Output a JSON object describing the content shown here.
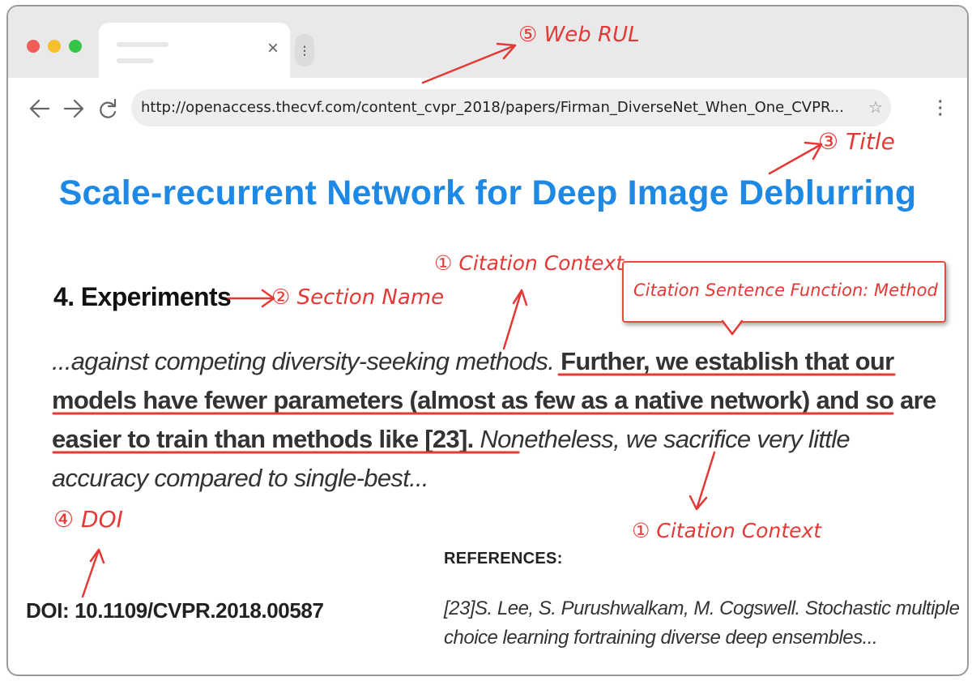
{
  "browser": {
    "tab": {
      "close_glyph": "×",
      "more_glyph": "⋮"
    },
    "nav": {
      "back_icon": "arrow-left-icon",
      "forward_icon": "arrow-right-icon",
      "reload_icon": "reload-icon"
    },
    "url": "http://openaccess.thecvf.com/content_cvpr_2018/papers/Firman_DiverseNet_When_One_CVPR...",
    "star_glyph": "☆",
    "menu_glyph": "⋮"
  },
  "page": {
    "title": "Scale-recurrent Network for Deep Image Deblurring",
    "section": "4. Experiments",
    "paragraph": {
      "context_before": "...against competing diversity-seeking methods.",
      "citation_sentence": "Further, we establish that our models have fewer parameters (almost as few as a native network) and so are easier to train than methods like [23].",
      "context_after": "Nonetheless, we sacrifice very little accuracy compared to single-best..."
    },
    "doi": "DOI: 10.1109/CVPR.2018.00587",
    "references_heading": "REFERENCES:",
    "reference": "[23]S. Lee, S. Purushwalkam, M. Cogswell. Stochastic multiple choice learning fortraining diverse deep ensembles..."
  },
  "annotations": {
    "web_url": "⑤ Web RUL",
    "title": "③ Title",
    "citation_context_top": "① Citation Context",
    "section_name": "② Section Name",
    "citation_context_bottom": "① Citation Context",
    "doi": "④ DOI",
    "sentence_function": "Citation Sentence Function: Method"
  },
  "colors": {
    "annotation_red": "#e53935",
    "title_blue": "#1e88e5",
    "tabbar_gray": "#e9e9ea"
  }
}
